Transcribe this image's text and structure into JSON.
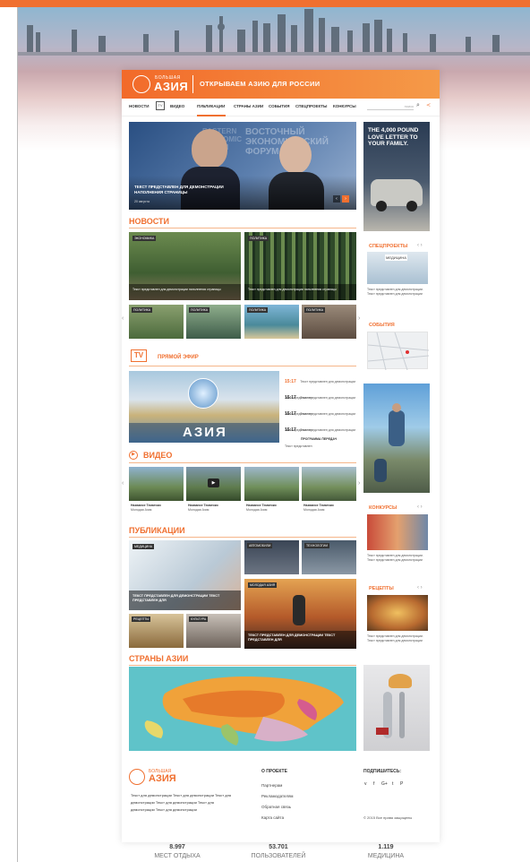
{
  "brand": {
    "small": "БОЛЬШАЯ",
    "big": "АЗИЯ",
    "tagline": "ОТКРЫВАЕМ АЗИЮ ДЛЯ РОССИИ"
  },
  "nav": {
    "items": [
      "НОВОСТИ",
      "TV",
      "ВИДЕО",
      "ПУБЛИКАЦИИ",
      "СТРАНЫ АЗИИ",
      "СОБЫТИЯ",
      "СПЕЦПРОЕКТЫ",
      "КОНКУРСЫ"
    ],
    "search_placeholder": "поиск"
  },
  "hero": {
    "caption": "ТЕКСТ ПРЕДСТАВЛЕН ДЛЯ ДЕМОНСТРАЦИИ НАПОЛНЕНИЯ СТРАНИЦЫ",
    "meta": "20 августа",
    "bg_text": "ВОСТОЧНЫЙ ЭКОНОМИЧЕСКИЙ ФОРУМ",
    "bg_text2": "EASTERN ECONOMIC FORUM"
  },
  "ad": {
    "headline": "THE 4,000 POUND LOVE LETTER TO YOUR FAMILY."
  },
  "news": {
    "title": "НОВОСТИ",
    "big_cards": [
      {
        "tag": "ЭКОНОМИКА",
        "caption": "Текст представлен для демонстрации наполнения страницы"
      },
      {
        "tag": "ПОЛИТИКА",
        "caption": "Текст представлен для демонстрации наполнения страницы"
      }
    ],
    "small_cards": [
      {
        "tag": "ПОЛИТИКА"
      },
      {
        "tag": "ПОЛИТИКА"
      },
      {
        "tag": "ПОЛИТИКА"
      },
      {
        "tag": "ПОЛИТИКА"
      }
    ]
  },
  "special": {
    "title": "СПЕЦПРОЕКТЫ",
    "label": "МЕДИЦИНА",
    "text": "Текст представлен для демонстрации. Текст представлен для демонстрации"
  },
  "events": {
    "title": "СОБЫТИЯ"
  },
  "tv": {
    "logo": "TV",
    "title": "ПРЯМОЙ ЭФИР",
    "channel": "АЗИЯ",
    "schedule": [
      {
        "time": "15:17",
        "text": "Текст представлен для демонстрации Текст представлен"
      },
      {
        "time": "15:17",
        "text": "Текст представлен для демонстрации Текст представлен"
      },
      {
        "time": "15:17",
        "text": "Текст представлен для демонстрации Текст представлен"
      },
      {
        "time": "15:17",
        "text": "Текст представлен для демонстрации Текст представлен"
      }
    ],
    "full_link": "ПРОГРАММА ПЕРЕДАЧ"
  },
  "video": {
    "title": "ВИДЕО",
    "items": [
      {
        "title": "Название Тематики",
        "meta": "Молодая Азия"
      },
      {
        "title": "Название Тематики",
        "meta": "Молодая Азия"
      },
      {
        "title": "Название Тематики",
        "meta": "Молодая Азия"
      },
      {
        "title": "Название Тематики",
        "meta": "Молодая Азия"
      }
    ]
  },
  "contests": {
    "title": "КОНКУРСЫ",
    "text": "Текст представлен для демонстрации. Текст представлен для демонстрации"
  },
  "publications": {
    "title": "ПУБЛИКАЦИИ",
    "main": {
      "tag": "МЕДИЦИНА",
      "caption": "ТЕКСТ ПРЕДСТАВЛЕН ДЛЯ ДЕМОНСТРАЦИИ ТЕКСТ ПРЕДСТАВЛЕН ДЛЯ"
    },
    "small": [
      {
        "tag": "АВТОМОБИЛИ"
      },
      {
        "tag": "ТЕХНОЛОГИИ"
      },
      {
        "tag": "РЕЦЕПТЫ"
      },
      {
        "tag": "КУЛЬТУРА"
      }
    ],
    "travel": {
      "tag": "МОЛОДАЯ АЗИЯ",
      "caption": "ТЕКСТ ПРЕДСТАВЛЕН ДЛЯ ДЕМОНСТРАЦИИ ТЕКСТ ПРЕДСТАВЛЕН ДЛЯ"
    }
  },
  "recipes": {
    "title": "РЕЦЕПТЫ",
    "text": "Текст представлен для демонстрации. Текст представлен для демонстрации"
  },
  "countries": {
    "title": "СТРАНЫ АЗИИ"
  },
  "footer": {
    "brand_small": "БОЛЬШАЯ",
    "brand_big": "АЗИЯ",
    "about": "Текст для демонстрации Текст для демонстрации Текст для демонстрации Текст для демонстрации Текст для демонстрации Текст для демонстрации",
    "project_title": "О ПРОЕКТЕ",
    "links": [
      "Партнерам",
      "Рекламодателям",
      "Обратная связь",
      "Карта сайта"
    ],
    "subscribe_title": "ПОДПИШИТЕСЬ:",
    "social": [
      "v",
      "f",
      "G+",
      "t",
      "P"
    ],
    "copyright": "© 2015 Все права защищены"
  },
  "stats": [
    {
      "num": "8.997",
      "label": "МЕСТ ОТДЫХА"
    },
    {
      "num": "53.701",
      "label": "ПОЛЬЗОВАТЕЛЕЙ"
    },
    {
      "num": "1.119",
      "label": "МЕДИЦИНА"
    }
  ],
  "colors": {
    "accent": "#f07030",
    "header_start": "#f26a2a",
    "header_end": "#f59a48"
  }
}
